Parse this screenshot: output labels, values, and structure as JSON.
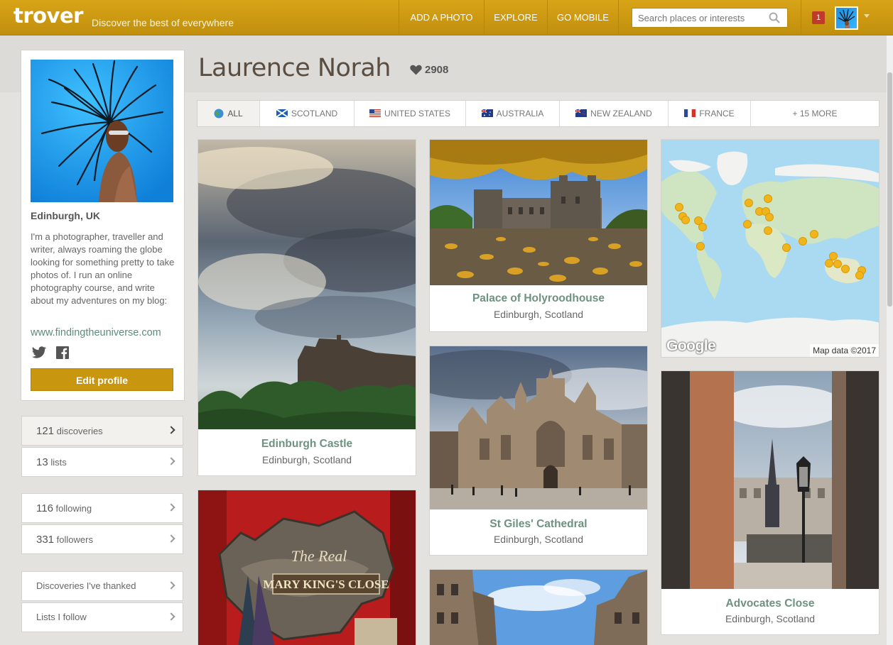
{
  "header": {
    "logo": "trover",
    "tagline": "Discover the best of everywhere",
    "nav": [
      "ADD A PHOTO",
      "EXPLORE",
      "GO MOBILE"
    ],
    "search_placeholder": "Search places or interests",
    "notification_count": "1",
    "brand_color": "#c8960f"
  },
  "profile": {
    "name": "Laurence Norah",
    "likes": "2908",
    "location": "Edinburgh, UK",
    "bio": "I'm a photographer, traveller and writer, always roaming the globe looking for something pretty to take photos of. I run an online photography course, and write about my adventures on my blog:",
    "website": "www.findingtheuniverse.com",
    "edit_label": "Edit profile"
  },
  "stats": [
    {
      "num": "121",
      "label": "discoveries"
    },
    {
      "num": "13",
      "label": "lists"
    },
    {
      "num": "116",
      "label": "following"
    },
    {
      "num": "331",
      "label": "followers"
    }
  ],
  "links": [
    "Discoveries I've thanked",
    "Lists I follow"
  ],
  "tabs": [
    {
      "label": "ALL",
      "icon": "globe-icon"
    },
    {
      "label": "SCOTLAND",
      "icon": "scotland-flag-icon"
    },
    {
      "label": "UNITED STATES",
      "icon": "us-flag-icon"
    },
    {
      "label": "AUSTRALIA",
      "icon": "australia-flag-icon"
    },
    {
      "label": "NEW ZEALAND",
      "icon": "new-zealand-flag-icon"
    },
    {
      "label": "FRANCE",
      "icon": "france-flag-icon"
    },
    {
      "label": "+ 15 MORE",
      "icon": ""
    }
  ],
  "cards": [
    {
      "title": "Edinburgh Castle",
      "location": "Edinburgh, Scotland"
    },
    {
      "title": "Palace of Holyroodhouse",
      "location": "Edinburgh, Scotland"
    },
    {
      "title": "St Giles' Cathedral",
      "location": "Edinburgh, Scotland"
    },
    {
      "title": "Advocates Close",
      "location": "Edinburgh, Scotland"
    }
  ],
  "sign_text": [
    "The Real",
    "MARY KING'S CLOSE"
  ],
  "map": {
    "logo": "Google",
    "attribution": "Map data ©2017"
  }
}
